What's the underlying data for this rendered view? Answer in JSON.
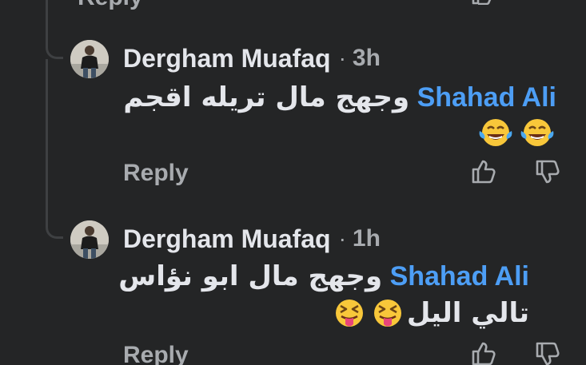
{
  "previous": {
    "reply_label": "Reply"
  },
  "comments": [
    {
      "author": "Dergham Muafaq",
      "dot": "·",
      "time": "3h",
      "mention": "Shahad Ali",
      "text_line1": "وجهج مال تريله اقجم",
      "text_line2": "",
      "emojis": [
        "face-with-tears-of-joy",
        "face-with-tears-of-joy"
      ],
      "reply_label": "Reply"
    },
    {
      "author": "Dergham Muafaq",
      "dot": "·",
      "time": "1h",
      "mention": "Shahad Ali",
      "text_line1": "وجهج مال ابو نؤاس",
      "text_line2": "تالي اليل",
      "emojis": [
        "squinting-face-with-tongue",
        "squinting-face-with-tongue"
      ],
      "reply_label": "Reply"
    }
  ],
  "icons": {
    "like": "thumbs-up-icon",
    "dislike": "thumbs-down-icon"
  },
  "colors": {
    "background": "#242526",
    "author": "#e4e6eb",
    "muted": "#a8abaf",
    "mention": "#4d9ef5",
    "thread_line": "#3e4042"
  }
}
